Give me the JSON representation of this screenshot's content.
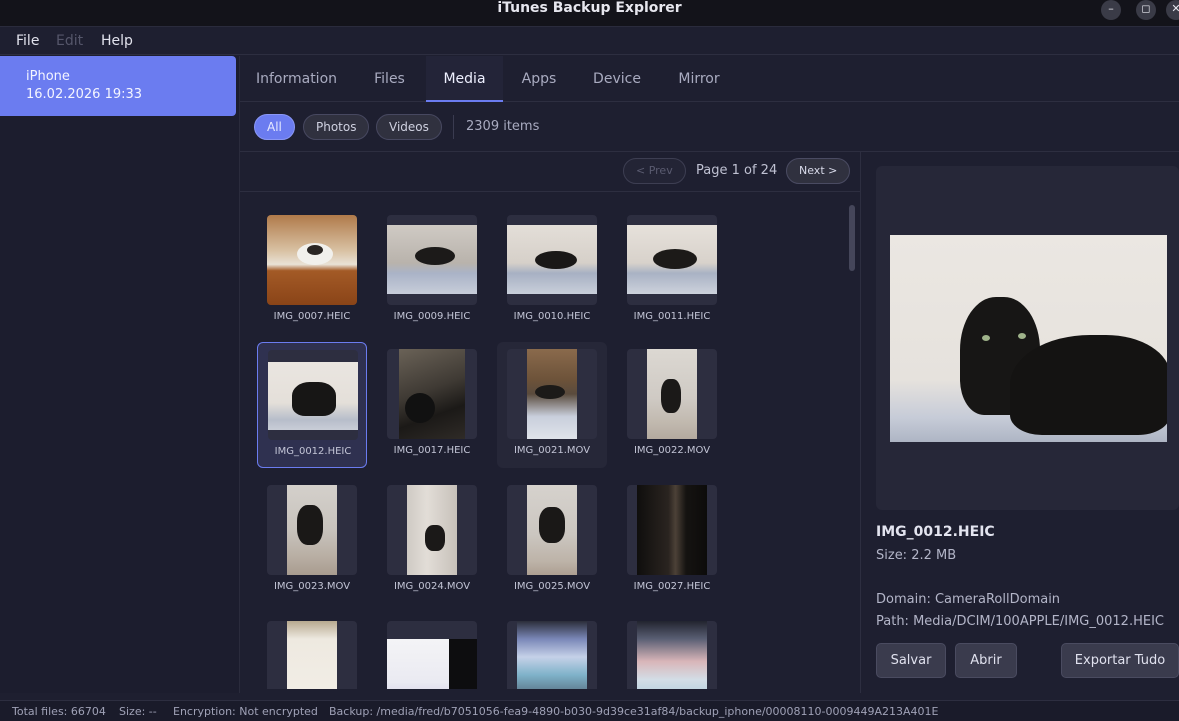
{
  "window": {
    "title": "iTunes Backup Explorer",
    "minimize_icon": "minimize-icon",
    "maximize_icon": "maximize-icon",
    "close_icon": "close-icon"
  },
  "menu": {
    "file": "File",
    "edit": "Edit",
    "help": "Help"
  },
  "sidebar": {
    "device": "iPhone",
    "date": "16.02.2026 19:33"
  },
  "tabs": [
    "Information",
    "Files",
    "Media",
    "Apps",
    "Device",
    "Mirror"
  ],
  "active_tab": "Media",
  "filters": {
    "all": "All",
    "photos": "Photos",
    "videos": "Videos",
    "count": "2309 items"
  },
  "pager": {
    "prev": "< Prev",
    "info": "Page 1 of 24",
    "next": "Next >"
  },
  "media": [
    "IMG_0007.HEIC",
    "IMG_0009.HEIC",
    "IMG_0010.HEIC",
    "IMG_0011.HEIC",
    "IMG_0012.HEIC",
    "IMG_0017.HEIC",
    "IMG_0021.MOV",
    "IMG_0022.MOV",
    "IMG_0023.MOV",
    "IMG_0024.MOV",
    "IMG_0025.MOV",
    "IMG_0027.HEIC"
  ],
  "preview": {
    "name": "IMG_0012.HEIC",
    "size": "Size: 2.2 MB",
    "domain": "Domain: CameraRollDomain",
    "path": "Path: Media/DCIM/100APPLE/IMG_0012.HEIC",
    "save": "Salvar",
    "open": "Abrir",
    "export_all": "Exportar Tudo"
  },
  "status": {
    "total": "Total files: 66704",
    "size": "Size: --",
    "encryption": "Encryption: Not encrypted",
    "backup": "Backup: /media/fred/b7051056-fea9-4890-b030-9d39ce31af84/backup_iphone/00008110-0009449A213A401E"
  },
  "colors": {
    "accent": "#6b7cf0",
    "background": "#1e1f30"
  }
}
